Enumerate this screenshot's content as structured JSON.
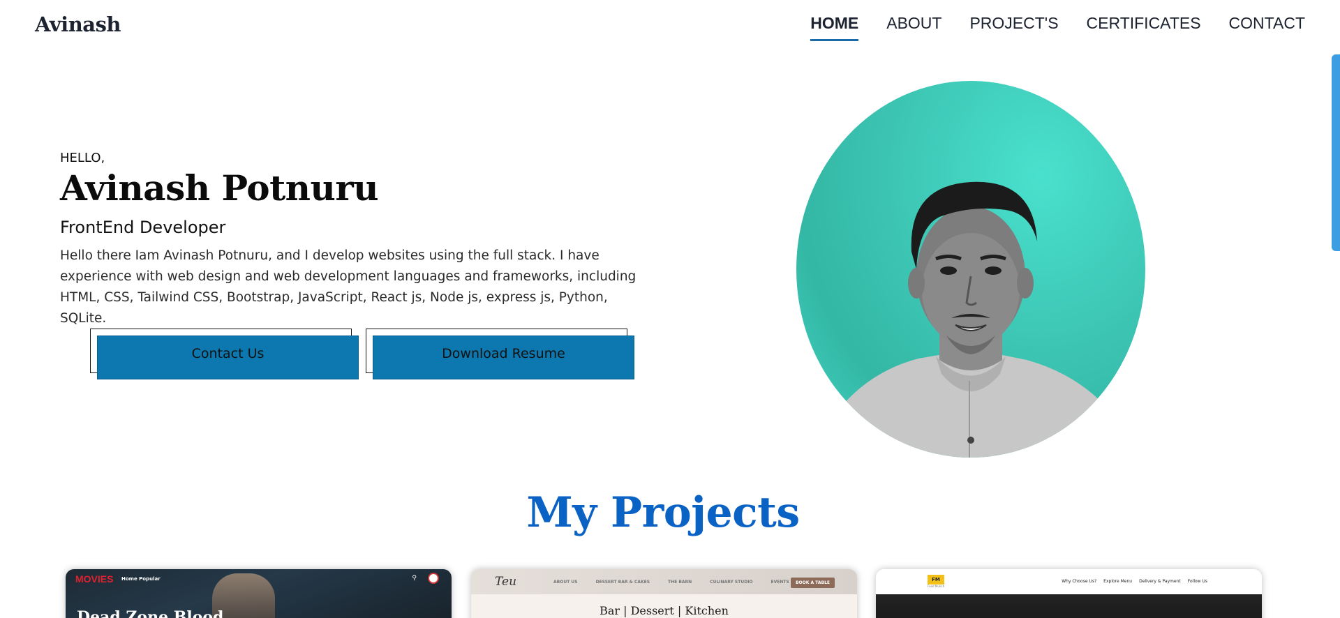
{
  "nav": {
    "logo": "Avinash",
    "links": [
      {
        "label": "HOME",
        "active": true
      },
      {
        "label": "ABOUT",
        "active": false
      },
      {
        "label": "PROJECT'S",
        "active": false
      },
      {
        "label": "CERTIFICATES",
        "active": false
      },
      {
        "label": "CONTACT",
        "active": false
      }
    ]
  },
  "hero": {
    "greeting": "HELLO,",
    "name": "Avinash Potnuru",
    "role": "FrontEnd Developer",
    "description": "Hello there Iam Avinash Potnuru, and I develop websites using the full stack. I have experience with web design and web development languages and frameworks, including HTML, CSS, Tailwind CSS, Bootstrap, JavaScript, React js, Node js, express js, Python, SQLite.",
    "buttons": {
      "contact": "Contact Us",
      "resume": "Download Resume"
    }
  },
  "projects": {
    "title": "My Projects",
    "cards": [
      {
        "brand": "MOVIES",
        "nav": "Home  Popular",
        "headline": "Dead Zone Blood"
      },
      {
        "logo": "Teu",
        "links": [
          "ABOUT US",
          "DESSERT BAR & CAKES",
          "THE BARN",
          "CULINARY STUDIO",
          "EVENTS"
        ],
        "cta": "BOOK A TABLE",
        "tagline": "Bar | Dessert | Kitchen"
      },
      {
        "logo": "FM",
        "logo_sub": "Food Munch",
        "links": [
          "Why Choose Us?",
          "Explore Menu",
          "Delivery & Payment",
          "Follow Us"
        ]
      }
    ]
  },
  "colors": {
    "accent": "#0a63c4",
    "button": "#0d78b0",
    "portrait_bg": "#3cc4b2"
  }
}
